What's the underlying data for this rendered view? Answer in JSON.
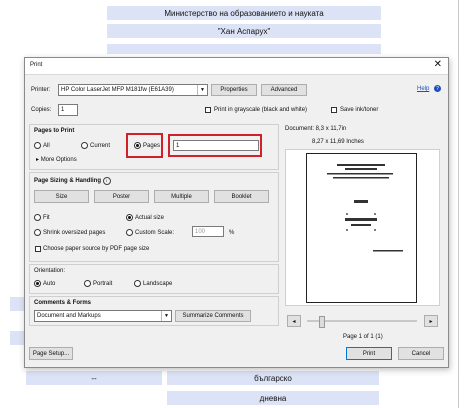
{
  "background": {
    "row1": "Министерство на образованието и науката",
    "row2": "\"Хан Аспарух\"",
    "row_dashes": "--",
    "row_lang": "българско",
    "row_daily": "дневна"
  },
  "dialog": {
    "title": "Print",
    "help": "Help",
    "printer_label": "Printer:",
    "printer_value": "HP Color LaserJet MFP M181fw (E61A39)",
    "properties_label": "Properties",
    "advanced_label": "Advanced",
    "copies_label": "Copies:",
    "copies_value": "1",
    "grayscale_label": "Print in grayscale (black and white)",
    "save_ink_label": "Save ink/toner",
    "pages_to_print": {
      "heading": "Pages to Print",
      "all": "All",
      "current": "Current",
      "pages": "Pages",
      "pages_value": "1",
      "more_options": "More Options"
    },
    "sizing": {
      "heading": "Page Sizing & Handling",
      "size": "Size",
      "poster": "Poster",
      "multiple": "Multiple",
      "booklet": "Booklet",
      "fit": "Fit",
      "actual_size": "Actual size",
      "shrink": "Shrink oversized pages",
      "custom_scale": "Custom Scale:",
      "custom_scale_value": "100",
      "percent": "%",
      "paper_source": "Choose paper source by PDF page size"
    },
    "orientation": {
      "heading": "Orientation:",
      "auto": "Auto",
      "portrait": "Portrait",
      "landscape": "Landscape"
    },
    "comments": {
      "heading": "Comments & Forms",
      "value": "Document and Markups",
      "summarize": "Summarize Comments"
    },
    "preview": {
      "doc_size": "Document: 8,3 x 11,7in",
      "paper_size": "8,27 x 11,69 Inches",
      "page_indicator": "Page 1 of 1 (1)"
    },
    "page_setup": "Page Setup...",
    "print_button": "Print",
    "cancel_button": "Cancel"
  }
}
